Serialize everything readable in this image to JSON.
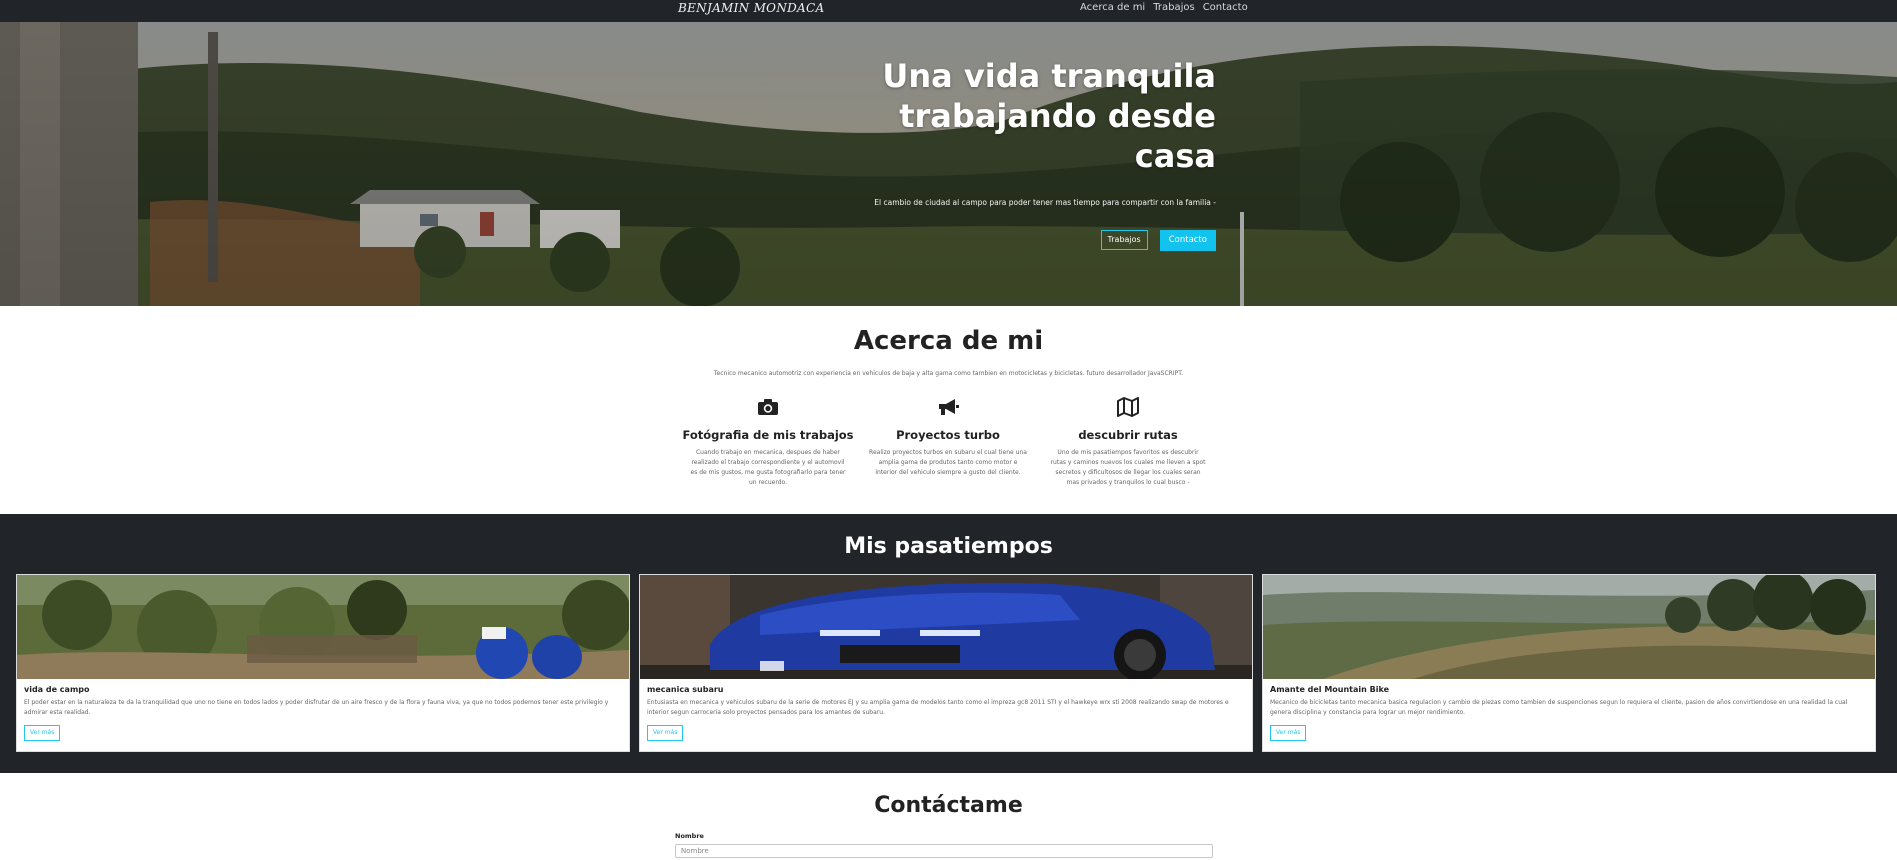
{
  "nav": {
    "brand": "BENJAMIN MONDACA",
    "links": [
      "Acerca de mi",
      "Trabajos",
      "Contacto"
    ]
  },
  "hero": {
    "title": "Una vida tranquila trabajando desde casa",
    "subtitle": "El cambio de ciudad al campo para poder tener mas tiempo para compartir con la familia -",
    "btn_works": "Trabajos",
    "btn_contact": "Contacto"
  },
  "about": {
    "title": "Acerca de mi",
    "lead": "Tecnico mecanico automotriz con experiencia en vehiculos de baja y alta gama como tambien en motocicletas y bicicletas. futuro desarrollador JavaSCRIPT.",
    "features": [
      {
        "icon": "camera-icon",
        "title": "Fotógrafia de mis trabajos",
        "text": "Cuando trabajo en mecanica, despues de haber realizado el trabajo correspondiente y el automovil es de mis gustos, me gusta fotografiarlo para tener un recuerdo."
      },
      {
        "icon": "megaphone-icon",
        "title": "Proyectos turbo",
        "text": "Realizo proyectos turbos en subaru el cual tiene una amplia gama de produtos tanto como motor e interior del vehiculo siempre a gusto del cliente."
      },
      {
        "icon": "map-icon",
        "title": "descubrir rutas",
        "text": "Uno de mis pasatiempos favoritos es descubrir rutas y caminos nuevos los cuales me lleven a spot secretos y dificultosos de llegar los cuales seran mas privados y tranquilos lo cual busco -"
      }
    ]
  },
  "hobbies": {
    "title": "Mis pasatiempos",
    "cards": [
      {
        "title": "vida de campo",
        "text": "El poder estar en la naturaleza te da la tranquilidad que uno no tiene en todos lados y poder disfrutar de un aire fresco y de la flora y fauna viva, ya que no todos podemos tener este privilegio y admirar esta realidad.",
        "button": "Ver más"
      },
      {
        "title": "mecanica subaru",
        "text": "Entusiasta en mecanica y vehiculos subaru de la serie de motores EJ y su amplia gama de modelos tanto como el impreza gc8 2011 STI y el hawkeye wrx sti 2008 realizando swap de motores e interior segun carroceria solo proyectos pensados para los amantes de subaru.",
        "button": "Ver más"
      },
      {
        "title": "Amante del Mountain Bike",
        "text": "Mecanico de bicicletas tanto mecanica basica regulacion y cambio de piezas como tambien de suspenciones segun lo requiera el cliente, pasion de años convirtiendose en una realidad la cual genera disciplina y constancia para lograr un mejor rendimiento.",
        "button": "Ver más"
      }
    ]
  },
  "contact": {
    "title": "Contáctame",
    "name_label": "Nombre",
    "name_placeholder": "Nombre"
  },
  "colors": {
    "accent": "#13c3ef",
    "dark": "#212529"
  }
}
